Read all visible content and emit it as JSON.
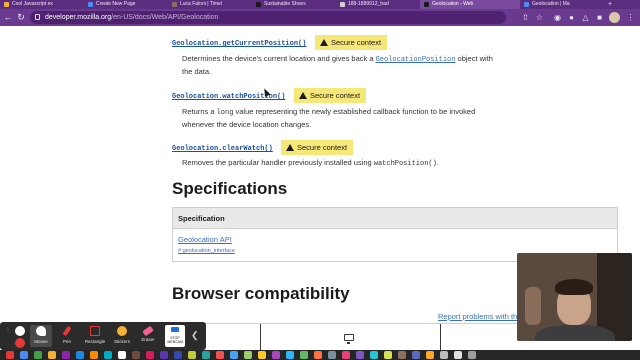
{
  "browser": {
    "tabs": [
      {
        "title": "Cool Javascript ex",
        "color": "#f2b233"
      },
      {
        "title": "Create New Page",
        "color": "#4c8bf5"
      },
      {
        "title": "Luca Faloni | Timel",
        "color": "#8d6e63"
      },
      {
        "title": "Sustainable Shoes",
        "color": "#1b1b1b"
      },
      {
        "title": "188-1889912_trad",
        "color": "#d0d0d0"
      },
      {
        "title": "Geolocation - Web",
        "color": "#1b1b1b"
      },
      {
        "title": "Geolocation | Ma",
        "color": "#4c8bf5"
      }
    ],
    "active_tab": 5,
    "url_host": "developer.mozilla.org",
    "url_path": "/en-US/docs/Web/API/Geolocation"
  },
  "methods": [
    {
      "name": "Geolocation.getCurrentPosition()",
      "badge": "Secure context",
      "desc_before": "Determines the device's current location and gives back a ",
      "desc_link": "GeolocationPosition",
      "desc_after": " object with the data."
    },
    {
      "name": "Geolocation.watchPosition()",
      "badge": "Secure context",
      "desc_before": "Returns a ",
      "desc_code": "long",
      "desc_after": " value representing the newly established callback function to be invoked whenever the device location changes."
    },
    {
      "name": "Geolocation.clearWatch()",
      "badge": "Secure context",
      "desc_before": "Removes the particular handler previously installed using ",
      "desc_code": "watchPosition()",
      "desc_after": "."
    }
  ],
  "specifications": {
    "heading": "Specifications",
    "column_header": "Specification",
    "link": "Geolocation API",
    "anchor": "# geolocation_interface"
  },
  "compat": {
    "heading": "Browser compatibility",
    "report_link": "Report problems with this"
  },
  "drawbar": {
    "tools": [
      "Mouse",
      "Pen",
      "Rectangle",
      "Stickers",
      "Eraser"
    ],
    "webcam_label": "STOP WEBCAM"
  }
}
